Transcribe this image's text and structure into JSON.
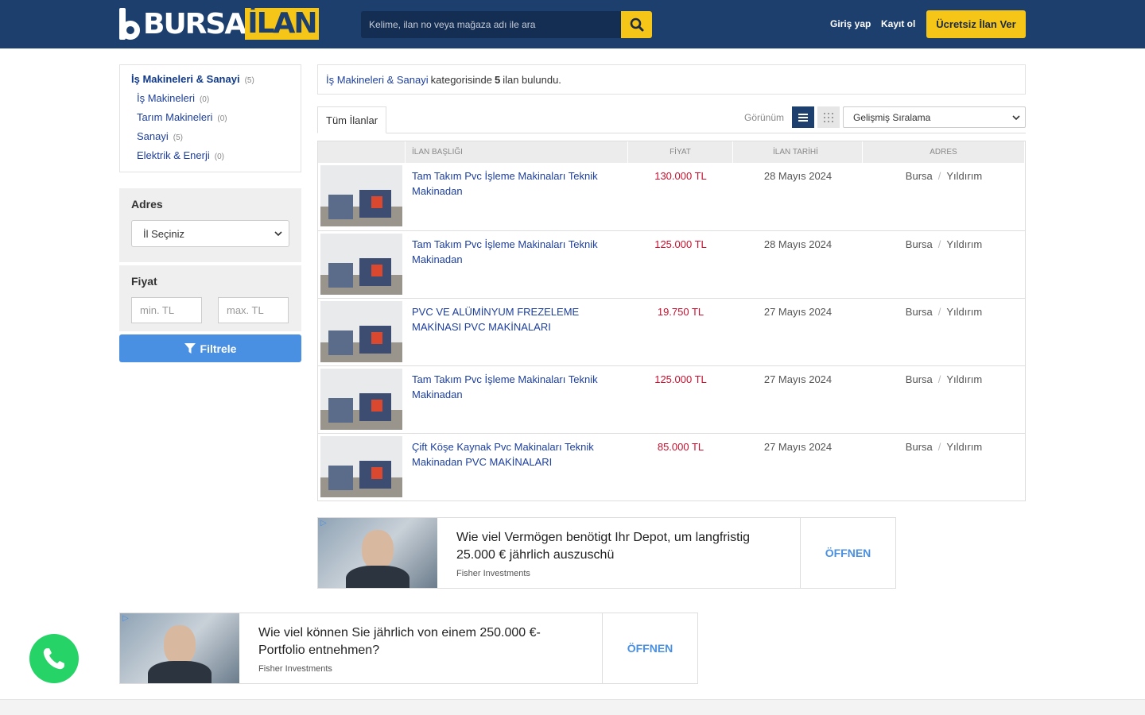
{
  "header": {
    "logo_a": "BURSA",
    "logo_b": "İLAN",
    "search_placeholder": "Kelime, ilan no veya mağaza adı ile ara",
    "login": "Giriş yap",
    "register": "Kayıt ol",
    "cta": "Ücretsiz İlan Ver",
    "colors": {
      "bar": "#1d3f6e",
      "accent": "#f5c518"
    }
  },
  "sidebar": {
    "categories": [
      {
        "label": "İş Makineleri & Sanayi",
        "count": "(5)",
        "level": "main"
      },
      {
        "label": "İş Makineleri",
        "count": "(0)",
        "level": "sub"
      },
      {
        "label": "Tarım Makineleri",
        "count": "(0)",
        "level": "sub"
      },
      {
        "label": "Sanayi",
        "count": "(5)",
        "level": "sub"
      },
      {
        "label": "Elektrik & Enerji",
        "count": "(0)",
        "level": "sub"
      }
    ],
    "address": {
      "title": "Adres",
      "select": "İl Seçiniz"
    },
    "price": {
      "title": "Fiyat",
      "min_placeholder": "min. TL",
      "max_placeholder": "max. TL"
    },
    "filter_button": "Filtrele"
  },
  "main": {
    "result": {
      "category": "İş Makineleri & Sanayi",
      "middle": "kategorisinde",
      "count": "5",
      "tail": "ilan bulundu."
    },
    "tab": "Tüm İlanlar",
    "view_label": "Görünüm",
    "sort": "Gelişmiş Sıralama",
    "columns": {
      "title": "İLAN BAŞLIĞI",
      "price": "FİYAT",
      "date": "İLAN TARİHİ",
      "address": "ADRES"
    },
    "rows": [
      {
        "title": "Tam Takım Pvc İşleme Makinaları Teknik Makinadan",
        "price": "130.000 TL",
        "date": "28 Mayıs 2024",
        "city": "Bursa",
        "district": "Yıldırım"
      },
      {
        "title": "Tam Takım Pvc İşleme Makinaları Teknik Makinadan",
        "price": "125.000 TL",
        "date": "28 Mayıs 2024",
        "city": "Bursa",
        "district": "Yıldırım"
      },
      {
        "title": "PVC VE ALÜMİNYUM FREZELEME MAKİNASI PVC MAKİNALARI",
        "price": "19.750 TL",
        "date": "27 Mayıs 2024",
        "city": "Bursa",
        "district": "Yıldırım"
      },
      {
        "title": "Tam Takım Pvc İşleme Makinaları Teknik Makinadan",
        "price": "125.000 TL",
        "date": "27 Mayıs 2024",
        "city": "Bursa",
        "district": "Yıldırım"
      },
      {
        "title": "Çift Köşe Kaynak Pvc Makinaları Teknik Makinadan PVC MAKİNALARI",
        "price": "85.000 TL",
        "date": "27 Mayıs 2024",
        "city": "Bursa",
        "district": "Yıldırım"
      }
    ]
  },
  "ads": [
    {
      "headline": "Wie viel Vermögen benötigt Ihr Depot, um langfristig 25.000 € jährlich auszuschü",
      "source": "Fisher Investments",
      "button": "ÖFFNEN"
    },
    {
      "headline": "Wie viel können Sie jährlich von einem 250.000 €-Portfolio entnehmen?",
      "source": "Fisher Investments",
      "button": "ÖFFNEN"
    }
  ],
  "icons": {
    "search": "search-icon",
    "filter": "filter-icon",
    "list": "list-view-icon",
    "grid": "grid-view-icon",
    "whatsapp": "whatsapp-icon",
    "ad": "ad-choices-icon"
  }
}
